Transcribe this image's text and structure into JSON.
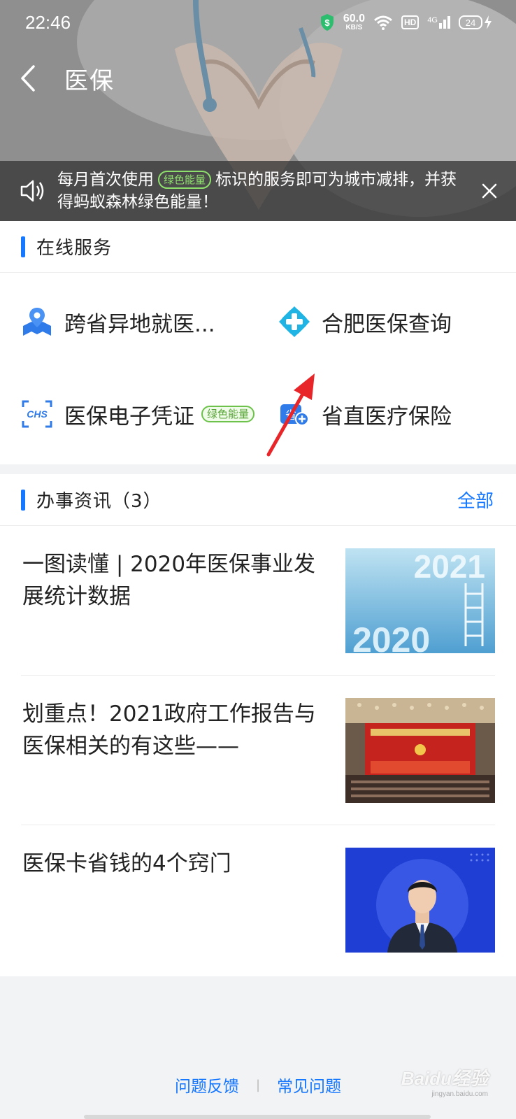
{
  "status_bar": {
    "time": "22:46",
    "net_speed_value": "60.0",
    "net_speed_unit": "KB/S",
    "hd_label": "HD",
    "network": "4G",
    "battery": "24"
  },
  "nav": {
    "title": "医保"
  },
  "notice": {
    "text_before": "每月首次使用",
    "tag": "绿色能量",
    "text_after": "标识的服务即可为城市减排，并获得蚂蚁森林绿色能量！"
  },
  "online_services": {
    "title": "在线服务",
    "items": [
      {
        "label": "跨省异地就医...",
        "icon": "map-location-icon"
      },
      {
        "label": "合肥医保查询",
        "icon": "medical-cross-icon"
      },
      {
        "label": "医保电子凭证",
        "icon": "chs-card-icon",
        "tag": "绿色能量"
      },
      {
        "label": "省直医疗保险",
        "icon": "province-insurance-icon"
      }
    ]
  },
  "news": {
    "title": "办事资讯（3）",
    "more": "全部",
    "items": [
      {
        "title": "一图读懂 | 2020年医保事业发展统计数据",
        "thumb_text_top": "2021",
        "thumb_text_bottom": "2020"
      },
      {
        "title": "划重点！2021政府工作报告与医保相关的有这些——"
      },
      {
        "title": "医保卡省钱的4个窍门"
      }
    ]
  },
  "footer": {
    "feedback": "问题反馈",
    "faq": "常见问题"
  },
  "watermark": {
    "brand": "Baidu经验",
    "url": "jingyan.baidu.com"
  },
  "colors": {
    "accent": "#1677ff",
    "green_tag": "#6cc24a",
    "arrow": "#e8262a"
  }
}
